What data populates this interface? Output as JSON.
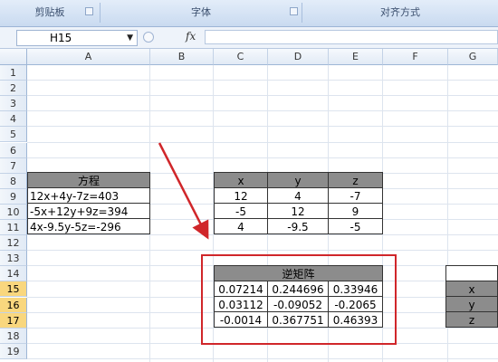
{
  "ribbon": {
    "groups": [
      "剪贴板",
      "字体",
      "对齐方式"
    ]
  },
  "formula_bar": {
    "name_box": "H15",
    "fx_label": "fx",
    "content": ""
  },
  "columns": [
    "A",
    "B",
    "C",
    "D",
    "E",
    "F",
    "G"
  ],
  "rows": [
    "1",
    "2",
    "3",
    "4",
    "5",
    "6",
    "7",
    "8",
    "9",
    "10",
    "11",
    "12",
    "13",
    "14",
    "15",
    "16",
    "17",
    "18",
    "19"
  ],
  "selected_rows": [
    "15",
    "16",
    "17"
  ],
  "equations": {
    "header": "方程",
    "items": [
      "12x+4y-7z=403",
      "-5x+12y+9z=394",
      "4x-9.5y-5z=-296"
    ]
  },
  "coefficients": {
    "headers": [
      "x",
      "y",
      "z"
    ],
    "rows": [
      [
        "12",
        "4",
        "-7"
      ],
      [
        "-5",
        "12",
        "9"
      ],
      [
        "4",
        "-9.5",
        "-5"
      ]
    ]
  },
  "inverse_matrix": {
    "header": "逆矩阵",
    "rows": [
      [
        "0.07214",
        "0.244696",
        "0.33946"
      ],
      [
        "0.03112",
        "-0.09052",
        "-0.2065"
      ],
      [
        "-0.0014",
        "0.367751",
        "0.46393"
      ]
    ]
  },
  "results": {
    "labels": [
      "x",
      "y",
      "z"
    ]
  },
  "annotation_color": "#d0262a"
}
